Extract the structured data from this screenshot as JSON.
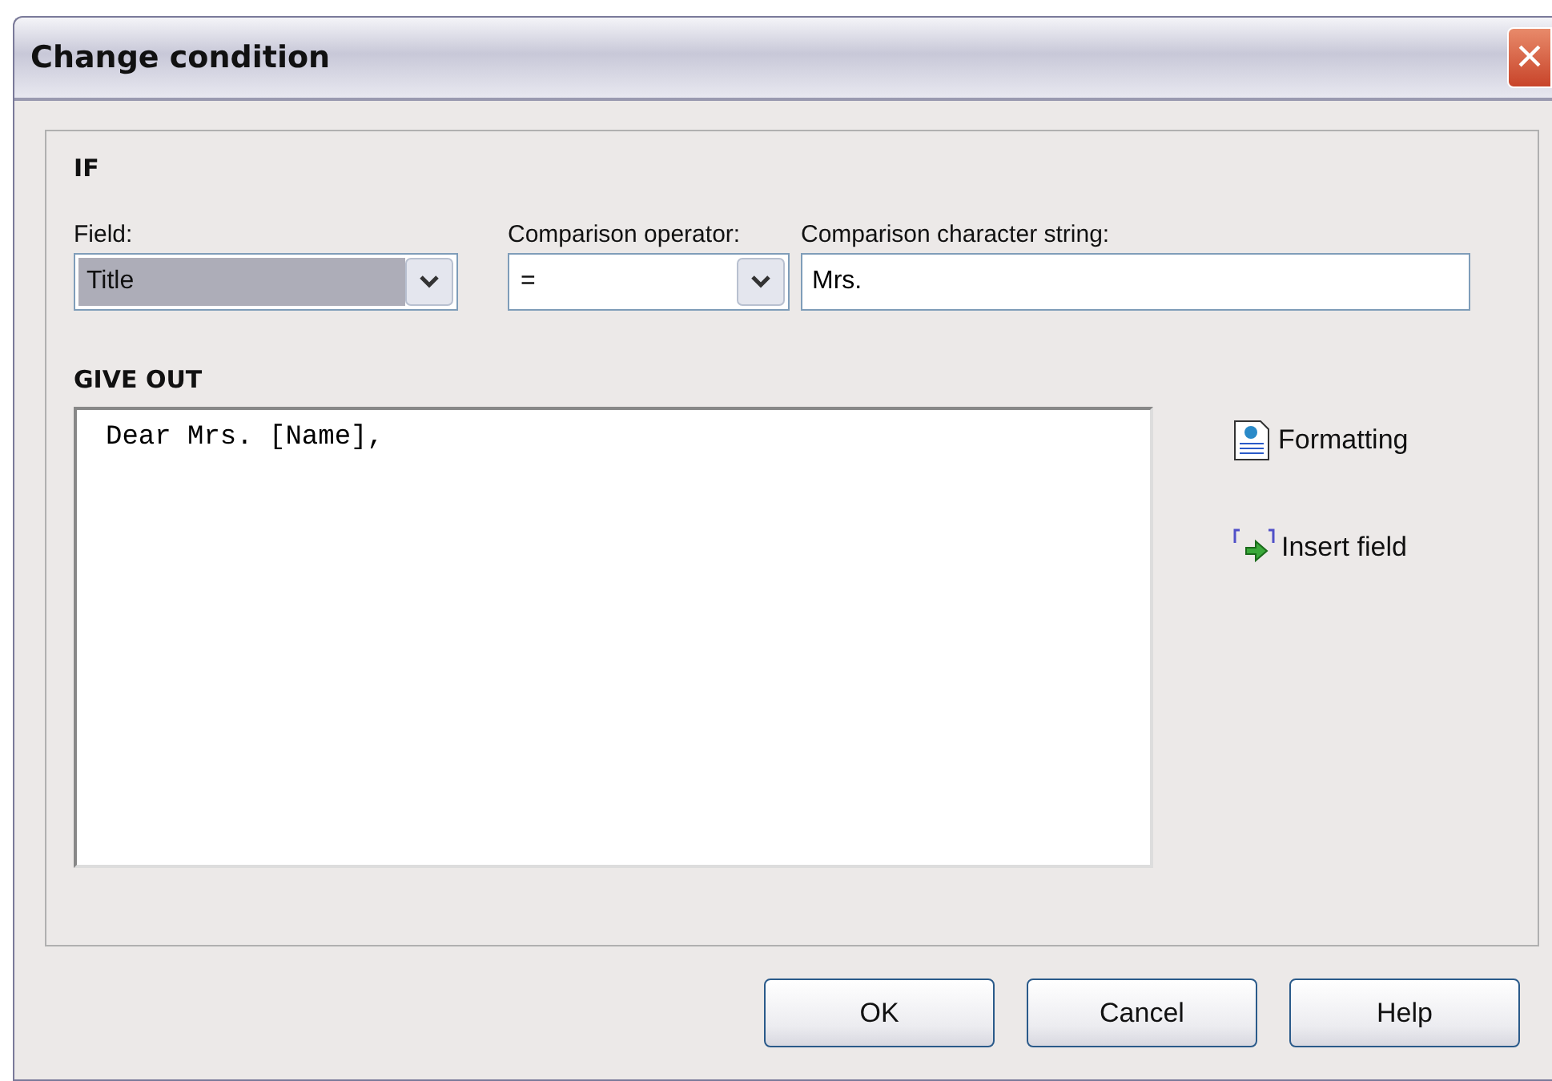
{
  "window": {
    "title": "Change condition",
    "close": "×"
  },
  "if_section": {
    "heading": "IF",
    "field": {
      "label": "Field:",
      "value": "Title",
      "highlighted": true
    },
    "operator": {
      "label": "Comparison operator:",
      "value": "=",
      "highlighted": false
    },
    "comparison_string": {
      "label": "Comparison character string:",
      "value": "Mrs."
    }
  },
  "give_out": {
    "heading": "GIVE OUT",
    "text": "Dear Mrs. [Name],",
    "actions": [
      {
        "kind": "formatting",
        "label": "Formatting"
      },
      {
        "kind": "insert",
        "label": "Insert field"
      }
    ]
  },
  "buttons": [
    "OK",
    "Cancel",
    "Help"
  ]
}
